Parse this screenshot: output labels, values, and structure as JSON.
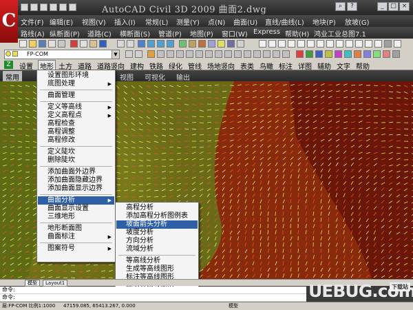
{
  "window": {
    "title": "AutoCAD Civil 3D 2009  曲面2.dwg",
    "logo_letter": "C"
  },
  "menubar1": [
    "文件(F)",
    "编辑(E)",
    "视图(V)",
    "插入(I)",
    "常规(L)",
    "测量(Y)",
    "点(N)",
    "曲面(U)",
    "直线/曲线(L)",
    "地块(P)",
    "放坡(G)"
  ],
  "menubar2": [
    "路线(A)",
    "纵断面(P)",
    "道路(C)",
    "横断面(S)",
    "管道(P)",
    "地图(P)",
    "窗口(W)",
    "Express",
    "帮助(H)",
    "鸿业工业总图7.1"
  ],
  "layer": {
    "name": "FP-COM"
  },
  "cnmenu": [
    "设置",
    "地形",
    "土方",
    "道路",
    "道路竖向",
    "建构",
    "铁路",
    "绿化",
    "管线",
    "场地竖向",
    "表类",
    "鸟瞰",
    "标注",
    "详图",
    "辅助",
    "文字",
    "帮助"
  ],
  "cnmenu_icon": "Z",
  "ribbon_tabs": [
    "常用",
    "视图",
    "可视化",
    "输出"
  ],
  "left_menu": {
    "items": [
      {
        "label": "设置图形环境",
        "submenu": false
      },
      {
        "label": "底图处理",
        "submenu": true
      },
      {
        "sep": true
      },
      {
        "label": "曲面管理",
        "submenu": false
      },
      {
        "sep": true
      },
      {
        "label": "定义等高线",
        "submenu": true
      },
      {
        "label": "定义高程点",
        "submenu": true
      },
      {
        "label": "高程检查",
        "submenu": false
      },
      {
        "label": "高程调整",
        "submenu": false
      },
      {
        "label": "高程修改",
        "submenu": false
      },
      {
        "sep": true
      },
      {
        "label": "定义陡坎",
        "submenu": false
      },
      {
        "label": "删除陡坎",
        "submenu": false
      },
      {
        "sep": true
      },
      {
        "label": "添加曲面外边界",
        "submenu": false
      },
      {
        "label": "添加曲面隐藏边界",
        "submenu": false
      },
      {
        "label": "添加曲面显示边界",
        "submenu": false
      },
      {
        "sep": true
      },
      {
        "label": "曲面分析",
        "submenu": true,
        "highlight": true
      },
      {
        "label": "曲面显示设置",
        "submenu": false
      },
      {
        "label": "三维地形",
        "submenu": false
      },
      {
        "sep": true
      },
      {
        "label": "地形断面图",
        "submenu": false
      },
      {
        "label": "曲面标注",
        "submenu": true
      },
      {
        "sep": true
      },
      {
        "label": "图案符号",
        "submenu": true
      }
    ]
  },
  "sub_menu": {
    "items": [
      {
        "label": "高程分析"
      },
      {
        "label": "添加高程分析图例表"
      },
      {
        "label": "坡面箭头分析",
        "highlight": true
      },
      {
        "label": "坡度分析"
      },
      {
        "label": "方向分析"
      },
      {
        "label": "流域分析"
      },
      {
        "sep": true
      },
      {
        "label": "等高线分析"
      },
      {
        "label": "生成等高线图形"
      },
      {
        "label": "标注等高线图形"
      },
      {
        "label": "裁剪等高线图形"
      }
    ]
  },
  "layout_tabs": [
    "模型",
    "Layout1"
  ],
  "command_lines": [
    "命令:",
    "命令:"
  ],
  "status": {
    "layer_info": "层:FP-COM 比例1:1000",
    "coords": "47159.085, 65413.267, 0.000",
    "model": "模型"
  },
  "watermark": {
    "text": "UEBUG.com",
    "tag": "下载站"
  },
  "colors": {
    "accent": "#2f5fa7",
    "surface_red": "#8a2a0c",
    "surface_olive": "#7a7a1a",
    "arrow_yellow": "#e8e84a"
  }
}
